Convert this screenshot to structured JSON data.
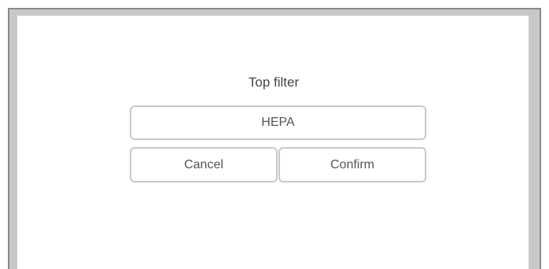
{
  "dialog": {
    "title": "Top filter",
    "selected_option": "HEPA",
    "cancel_label": "Cancel",
    "confirm_label": "Confirm"
  },
  "colors": {
    "frame_background": "#c8c8c8",
    "frame_border": "#8a8a8a",
    "panel_background": "#ffffff",
    "control_border": "#c8c8c8",
    "text": "#555555"
  }
}
